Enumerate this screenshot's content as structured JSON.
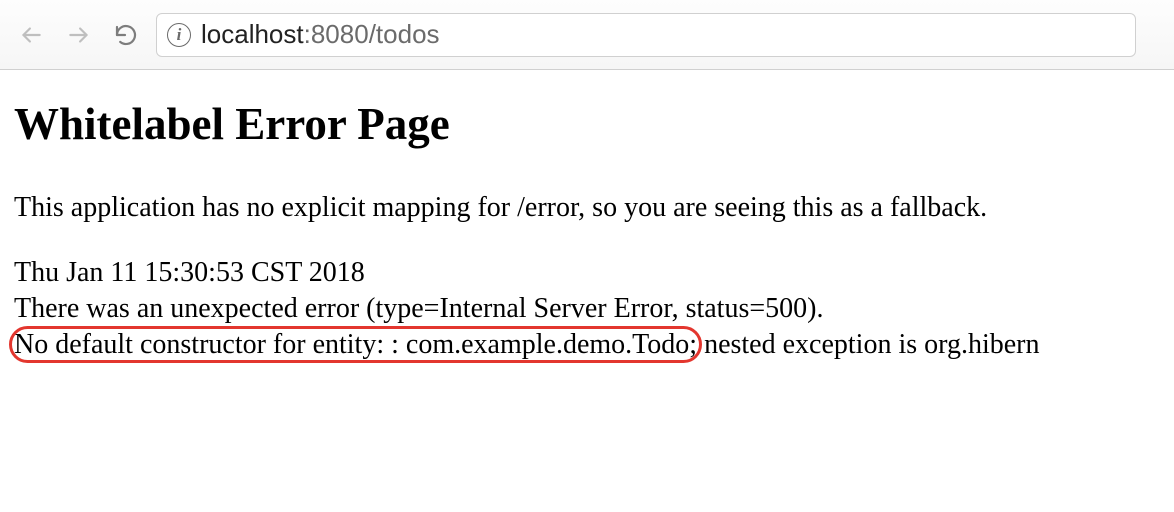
{
  "browser": {
    "url": {
      "host": "localhost",
      "port": ":8080",
      "path": "/todos"
    }
  },
  "error": {
    "title": "Whitelabel Error Page",
    "subtitle": "This application has no explicit mapping for /error, so you are seeing this as a fallback.",
    "timestamp": "Thu Jan 11 15:30:53 CST 2018",
    "summary": "There was an unexpected error (type=Internal Server Error, status=500).",
    "exception_highlighted": "No default constructor for entity: : com.example.demo.Todo;",
    "exception_rest": " nested exception is org.hibern"
  },
  "annotation": {
    "highlight_color": "#e3362e"
  }
}
